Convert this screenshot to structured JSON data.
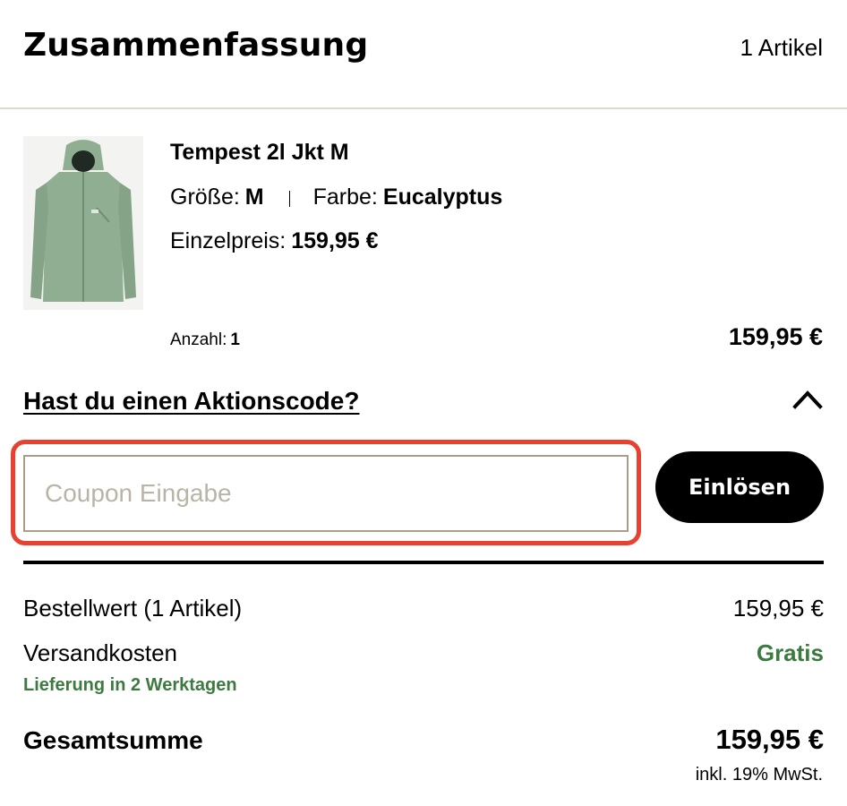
{
  "summary": {
    "title": "Zusammenfassung",
    "item_count": "1 Artikel"
  },
  "product": {
    "image_icon": "jacket-image",
    "name": "Tempest 2l Jkt M",
    "size_label": "Größe:",
    "size_value": "M",
    "color_label": "Farbe:",
    "color_value": "Eucalyptus",
    "unit_price_label": "Einzelpreis:",
    "unit_price_value": "159,95 €",
    "quantity_label": "Anzahl:",
    "quantity_value": "1",
    "line_total": "159,95 €"
  },
  "promo": {
    "question": "Hast du einen Aktionscode?",
    "toggle_icon": "chevron-up-icon",
    "input_value": "",
    "input_placeholder": "Coupon Eingabe",
    "redeem_label": "Einlösen"
  },
  "totals": {
    "order_value_label": "Bestellwert (1 Artikel)",
    "order_value": "159,95 €",
    "shipping_label": "Versandkosten",
    "shipping_value": "Gratis",
    "delivery_note": "Lieferung in 2 Werktagen",
    "grand_total_label": "Gesamtsumme",
    "grand_total": "159,95 €",
    "vat_note": "inkl. 19% MwSt."
  },
  "colors": {
    "accent_green": "#3c7a3f",
    "highlight_red": "#e8412f",
    "input_border": "#a79f89",
    "placeholder": "#b9b5a6",
    "product_jacket": "#8fae92"
  }
}
